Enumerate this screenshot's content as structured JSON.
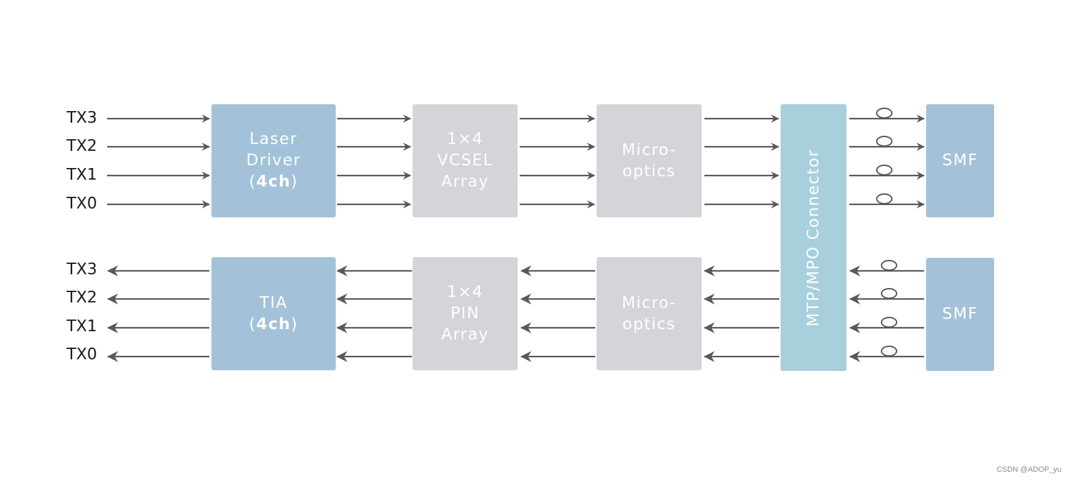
{
  "diagram": {
    "tx_path": {
      "inputs": [
        "TX3",
        "TX2",
        "TX1",
        "TX0"
      ],
      "blocks": [
        {
          "id": "laser-driver",
          "lines": [
            "Laser",
            "Driver",
            "(4ch)"
          ],
          "bold_suffix": "4ch"
        },
        {
          "id": "vcsel-array",
          "lines": [
            "1×4",
            "VCSEL",
            "Array"
          ]
        },
        {
          "id": "micro-optics-tx",
          "lines": [
            "Micro-",
            "optics"
          ]
        },
        {
          "id": "smf-tx",
          "lines": [
            "SMF"
          ]
        }
      ]
    },
    "rx_path": {
      "outputs": [
        "TX3",
        "TX2",
        "TX1",
        "TX0"
      ],
      "blocks": [
        {
          "id": "tia",
          "lines": [
            "TIA",
            "(4ch)"
          ],
          "bold_suffix": "4ch"
        },
        {
          "id": "pin-array",
          "lines": [
            "1×4",
            "PIN",
            "Array"
          ]
        },
        {
          "id": "micro-optics-rx",
          "lines": [
            "Micro-",
            "optics"
          ]
        },
        {
          "id": "smf-rx",
          "lines": [
            "SMF"
          ]
        }
      ]
    },
    "connector": {
      "label": "MTP/MPO Connector"
    },
    "channels_per_path": 4,
    "colors": {
      "driver_block": "#a3c2d9",
      "optical_block": "#d3d5d9",
      "connector_block": "#a8cfdc",
      "arrow": "#595959"
    }
  },
  "watermark": "CSDN @ADOP_yu"
}
